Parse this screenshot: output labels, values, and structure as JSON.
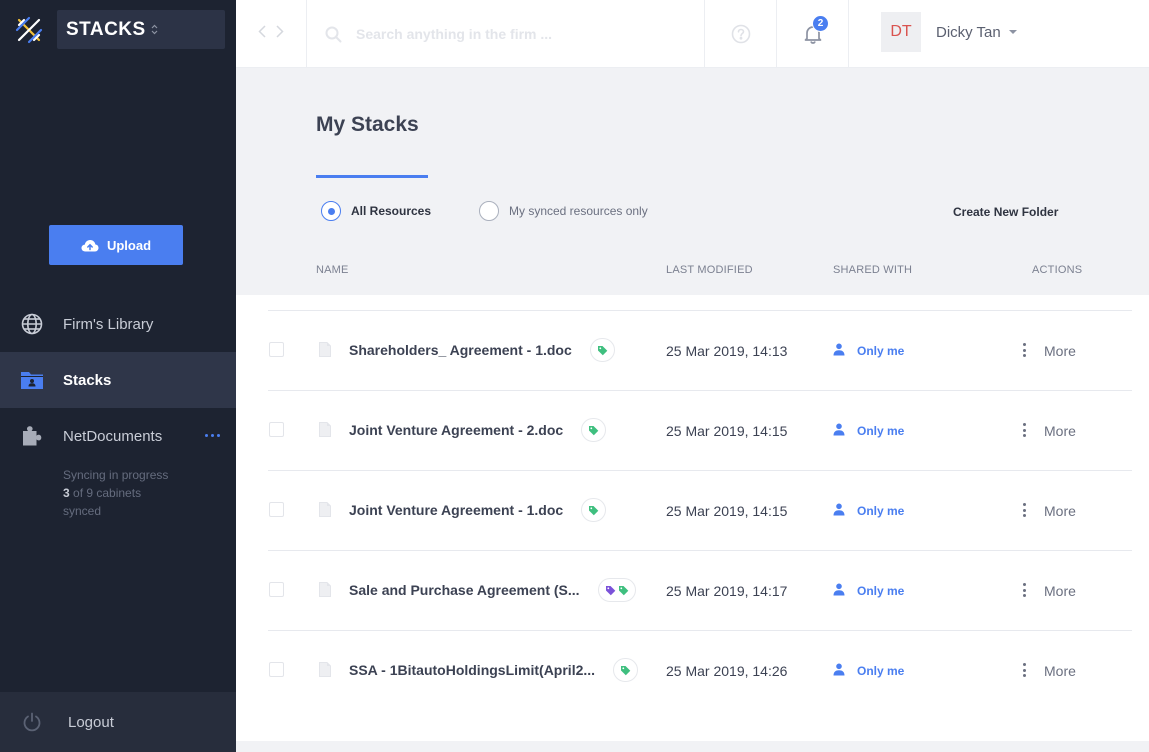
{
  "sidebar": {
    "app_name": "STACKS",
    "upload_label": "Upload",
    "nav": [
      {
        "label": "Firm's Library"
      },
      {
        "label": "Stacks"
      },
      {
        "label": "NetDocuments"
      }
    ],
    "sync": {
      "line1": "Syncing in progress",
      "count": "3",
      "line2_rest": " of 9 cabinets",
      "line3": "synced"
    },
    "logout_label": "Logout"
  },
  "topbar": {
    "search_placeholder": "Search anything in the firm ...",
    "notification_count": "2",
    "user_initials": "DT",
    "user_name": "Dicky Tan"
  },
  "main": {
    "title": "My Stacks",
    "filters": [
      {
        "label": "All Resources",
        "selected": true
      },
      {
        "label": "My synced resources only",
        "selected": false
      }
    ],
    "create_folder_label": "Create New Folder",
    "columns": [
      "NAME",
      "LAST MODIFIED",
      "SHARED WITH",
      "ACTIONS"
    ],
    "rows": [
      {
        "name": "Shareholders_ Agreement - 1.doc",
        "tags": [
          "green"
        ],
        "modified": "25 Mar 2019, 14:13",
        "shared": "Only me",
        "action": "More"
      },
      {
        "name": "Joint Venture Agreement - 2.doc",
        "tags": [
          "green"
        ],
        "modified": "25 Mar 2019, 14:15",
        "shared": "Only me",
        "action": "More"
      },
      {
        "name": "Joint Venture Agreement - 1.doc",
        "tags": [
          "green"
        ],
        "modified": "25 Mar 2019, 14:15",
        "shared": "Only me",
        "action": "More"
      },
      {
        "name": "Sale and Purchase Agreement (S...",
        "tags": [
          "purple",
          "green"
        ],
        "modified": "25 Mar 2019, 14:17",
        "shared": "Only me",
        "action": "More"
      },
      {
        "name": "SSA - 1BitautoHoldingsLimit(April2...",
        "tags": [
          "green"
        ],
        "modified": "25 Mar 2019, 14:26",
        "shared": "Only me",
        "action": "More"
      }
    ]
  },
  "colors": {
    "sidebar_bg": "#1d2331",
    "accent": "#4a7ef0",
    "tag_green": "#3fbf7f",
    "tag_purple": "#7b52d9",
    "avatar_text": "#d9534f"
  }
}
